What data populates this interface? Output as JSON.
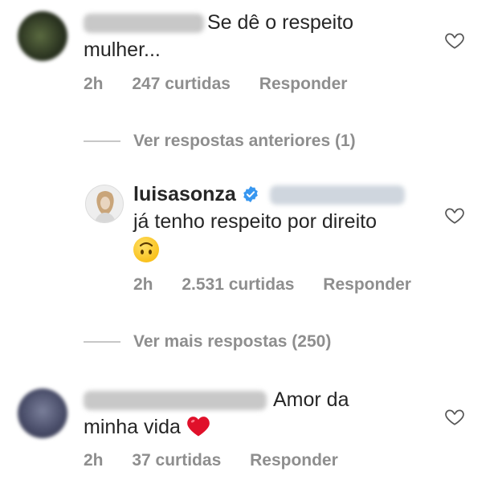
{
  "comments": [
    {
      "text_line1": "Se dê o respeito",
      "text_line2": "mulher...",
      "time": "2h",
      "likes": "247 curtidas",
      "reply": "Responder"
    },
    {
      "view_previous": "Ver respostas anteriores (1)",
      "username": "luisasonza",
      "text": "já tenho respeito por direito",
      "emoji": "upside-down-face",
      "time": "2h",
      "likes": "2.531 curtidas",
      "reply": "Responder"
    },
    {
      "view_more": "Ver mais respostas (250)",
      "text_line1": "Amor da",
      "text_line2": "minha vida",
      "emoji": "red-heart",
      "time": "2h",
      "likes": "37 curtidas",
      "reply": "Responder"
    }
  ],
  "colors": {
    "text": "#262626",
    "muted": "#8e8e8e",
    "verified": "#3897f0",
    "heart": "#e0102a"
  }
}
